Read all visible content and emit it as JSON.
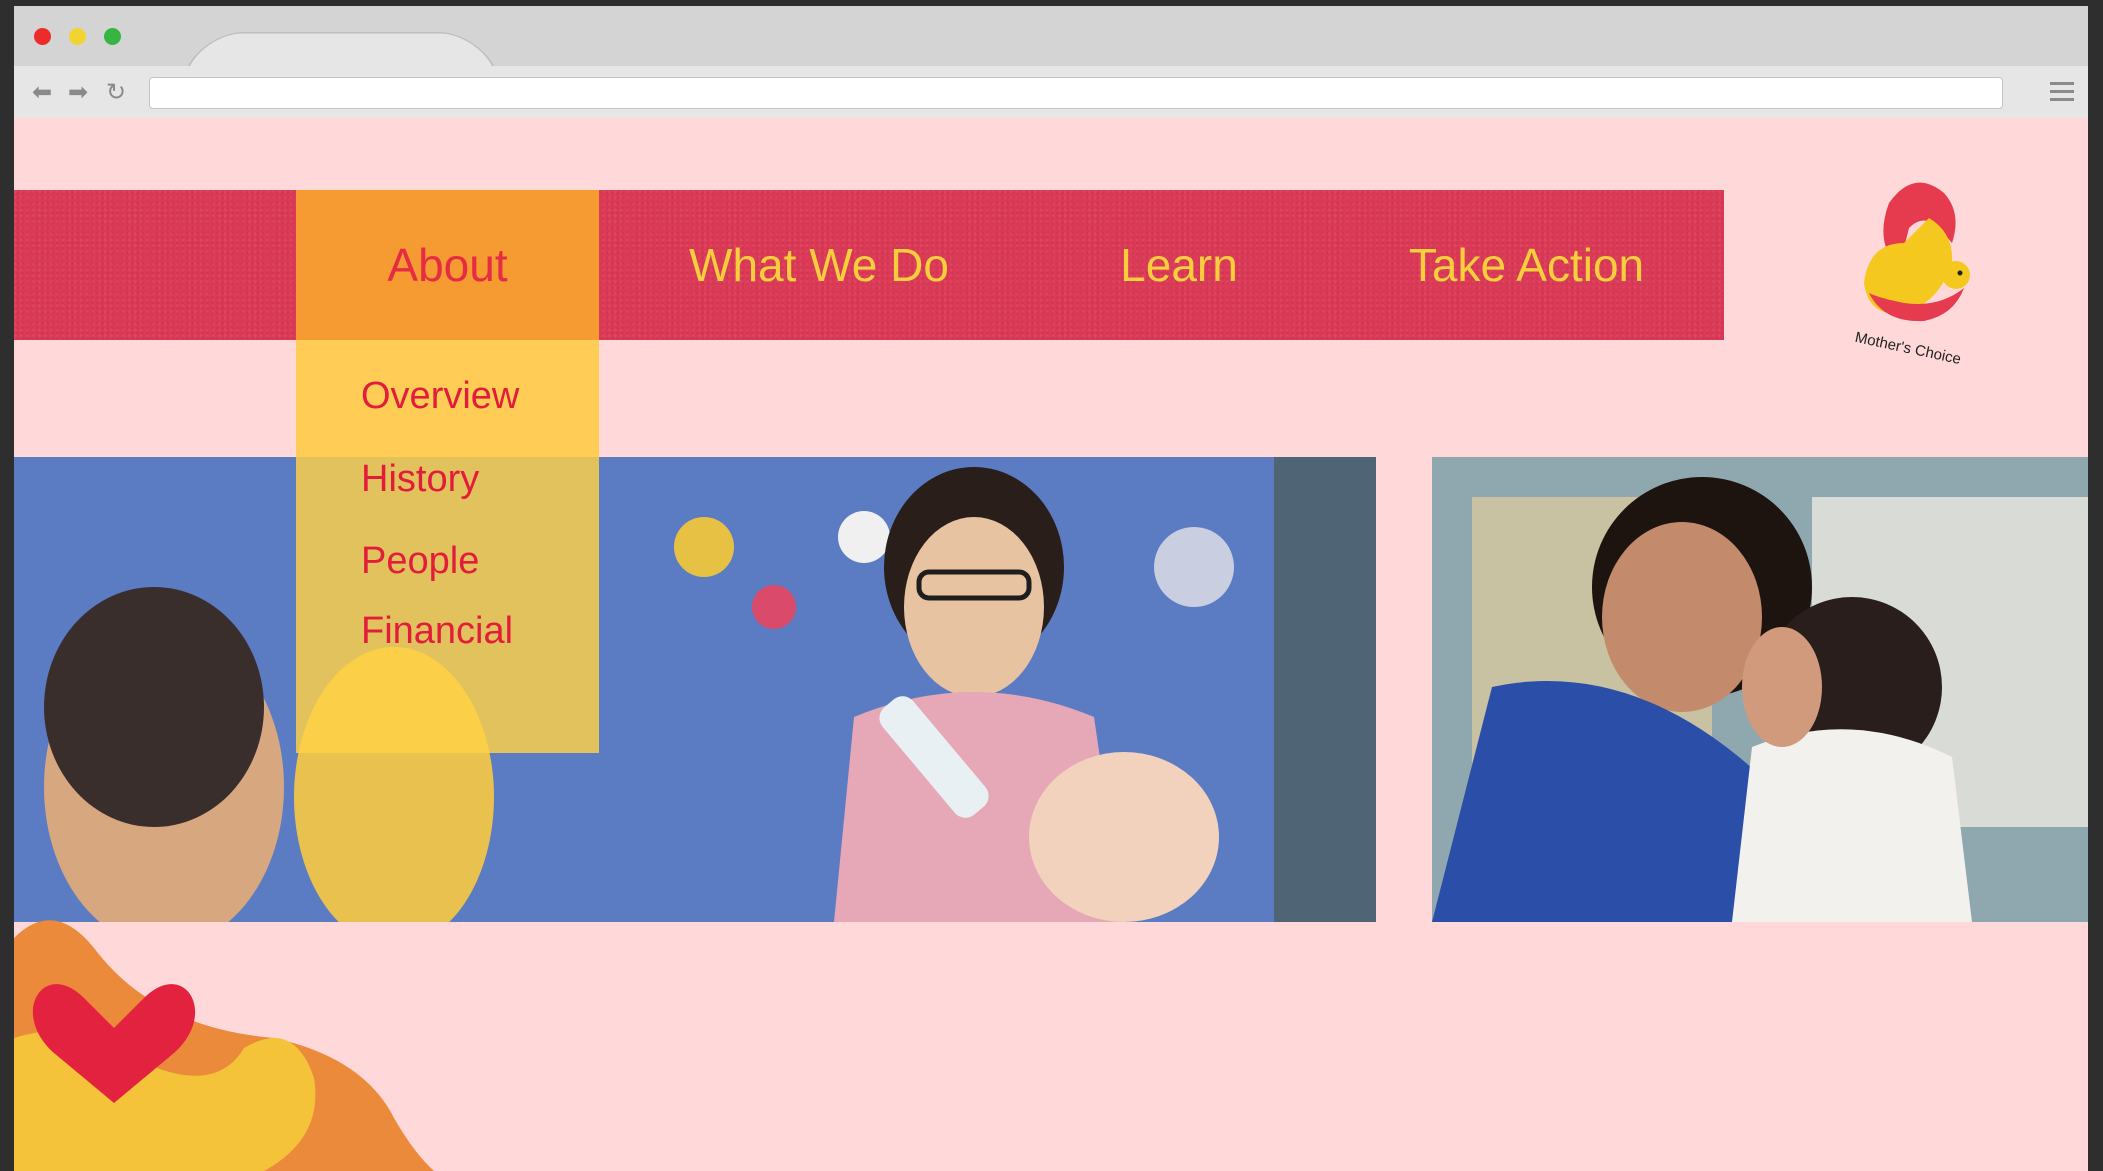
{
  "nav": {
    "items": [
      {
        "label": "About",
        "active": true
      },
      {
        "label": "What We Do"
      },
      {
        "label": "Learn"
      },
      {
        "label": "Take Action"
      }
    ]
  },
  "about_menu": {
    "items": [
      "Overview",
      "History",
      "People",
      "Financial"
    ]
  },
  "logo": {
    "text": "Mother's Choice"
  },
  "colors": {
    "page_bg": "#ffd9d9",
    "nav_bg": "#dd3a57",
    "nav_text": "#f7cf3c",
    "active_bg": "#f59b31",
    "active_text": "#e62b45",
    "dropdown_bg": "#ffd246",
    "dropdown_text": "#e21d3c"
  },
  "icons": [
    "back-arrow-icon",
    "forward-arrow-icon",
    "reload-icon",
    "hamburger-menu-icon"
  ]
}
